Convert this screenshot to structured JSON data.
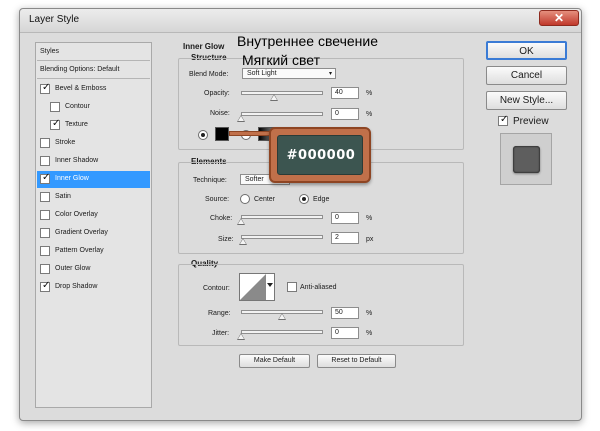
{
  "window": {
    "title": "Layer Style",
    "close_symbol": "✕"
  },
  "overlay": {
    "line1": "Внутреннее свечение",
    "line2": "Мягкий свет",
    "hex_label": "#000000"
  },
  "styles_list": {
    "items": [
      {
        "label": "Styles",
        "checkbox": false,
        "checked": false,
        "selected": false
      },
      {
        "label": "Blending Options: Default",
        "checkbox": false,
        "checked": false,
        "selected": false
      },
      {
        "label": "Bevel & Emboss",
        "checkbox": true,
        "checked": true,
        "selected": false
      },
      {
        "label": "Contour",
        "checkbox": true,
        "checked": false,
        "selected": false
      },
      {
        "label": "Texture",
        "checkbox": true,
        "checked": true,
        "selected": false
      },
      {
        "label": "Stroke",
        "checkbox": true,
        "checked": false,
        "selected": false
      },
      {
        "label": "Inner Shadow",
        "checkbox": true,
        "checked": false,
        "selected": false
      },
      {
        "label": "Inner Glow",
        "checkbox": true,
        "checked": true,
        "selected": true
      },
      {
        "label": "Satin",
        "checkbox": true,
        "checked": false,
        "selected": false
      },
      {
        "label": "Color Overlay",
        "checkbox": true,
        "checked": false,
        "selected": false
      },
      {
        "label": "Gradient Overlay",
        "checkbox": true,
        "checked": false,
        "selected": false
      },
      {
        "label": "Pattern Overlay",
        "checkbox": true,
        "checked": false,
        "selected": false
      },
      {
        "label": "Outer Glow",
        "checkbox": true,
        "checked": false,
        "selected": false
      },
      {
        "label": "Drop Shadow",
        "checkbox": true,
        "checked": true,
        "selected": false
      }
    ]
  },
  "inner_glow": {
    "title": "Inner Glow",
    "structure": {
      "title": "Structure",
      "blend_mode_label": "Blend Mode:",
      "blend_mode_value": "Soft Light",
      "opacity_label": "Opacity:",
      "opacity_value": "40",
      "opacity_fraction": 0.4,
      "noise_label": "Noise:",
      "noise_value": "0",
      "noise_fraction": 0,
      "percent": "%",
      "glow_color": "#000000"
    },
    "elements": {
      "title": "Elements",
      "technique_label": "Technique:",
      "technique_value": "Softer",
      "source_label": "Source:",
      "source_center": "Center",
      "source_edge": "Edge",
      "choke_label": "Choke:",
      "choke_value": "0",
      "choke_fraction": 0,
      "size_label": "Size:",
      "size_value": "2",
      "size_unit": "px",
      "percent": "%"
    },
    "quality": {
      "title": "Quality",
      "contour_label": "Contour:",
      "anti_aliased_label": "Anti-aliased",
      "range_label": "Range:",
      "range_value": "50",
      "range_fraction": 0.5,
      "jitter_label": "Jitter:",
      "jitter_value": "0",
      "jitter_fraction": 0,
      "percent": "%"
    },
    "make_default": "Make Default",
    "reset_default": "Reset to Default"
  },
  "right_panel": {
    "ok": "OK",
    "cancel": "Cancel",
    "new_style": "New Style...",
    "preview_label": "Preview",
    "preview_checked": true
  }
}
